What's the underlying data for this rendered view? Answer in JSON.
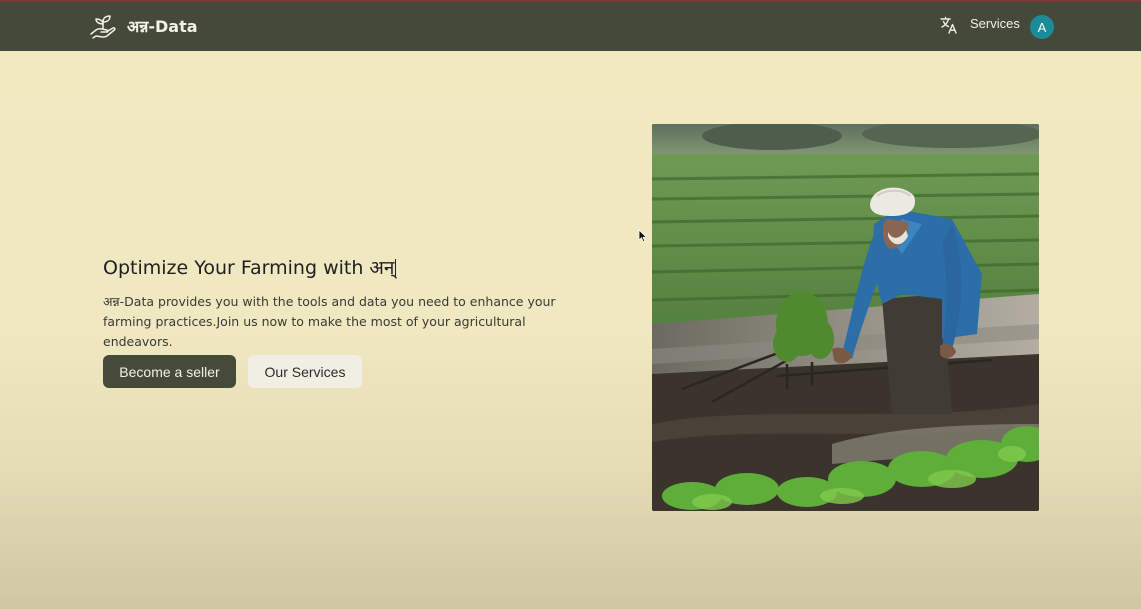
{
  "app": {
    "brand_name": "अन्न-Data",
    "logo_icon": "hand-holding-sprout-icon",
    "translate_icon": "translate-icon"
  },
  "navbar": {
    "services_label": "Services",
    "avatar_initial": "A"
  },
  "hero": {
    "heading": "Optimize Your Farming with अन्",
    "description": "अन्न-Data provides you with the tools and data you need to enhance your farming practices.Join us now to make the most of your agricultural endeavors.",
    "primary_button": "Become a seller",
    "secondary_button": "Our Services",
    "image_subject": "farmer-working-in-field-image"
  },
  "colors": {
    "navbar_bg": "#45493a",
    "page_bg": "#f1e9c0",
    "primary_button_bg": "#464b39",
    "secondary_button_bg": "#f1eee4",
    "avatar_bg": "#1a8c98"
  }
}
